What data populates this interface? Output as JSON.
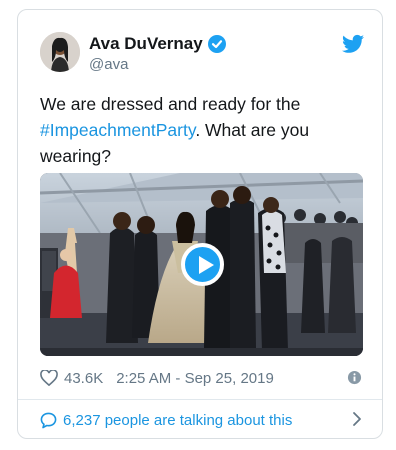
{
  "tweet": {
    "author_name": "Ava DuVernay",
    "author_handle": "@ava",
    "text_before": "We are dressed and ready for the ",
    "hashtag": "#ImpeachmentParty",
    "text_after": ". What are you wearing?",
    "likes": "43.6K",
    "timestamp": "2:25 AM - Sep 25, 2019",
    "talking_text": "6,237 people are talking about this"
  },
  "colors": {
    "accent": "#1da1f2",
    "link": "#1b95e0",
    "muted": "#657786"
  },
  "icons": [
    "verified-badge-icon",
    "twitter-logo-icon",
    "play-icon",
    "heart-icon",
    "info-icon",
    "speech-bubble-icon",
    "chevron-right-icon"
  ]
}
